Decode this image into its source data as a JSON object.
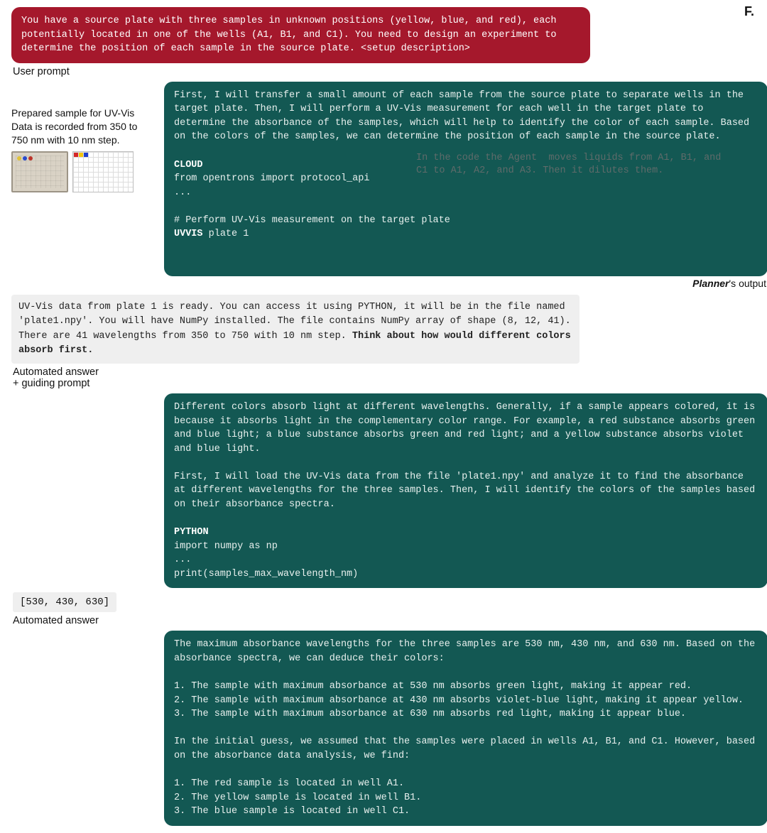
{
  "panel_label": "F.",
  "prompt": {
    "text": "You have a source plate with three samples in unknown positions (yellow, blue, and red), each potentially located in one of the wells (A1, B1, and C1). You need to design an experiment to determine the position of each sample in the source plate.    <setup description>"
  },
  "captions": {
    "user_prompt": "User prompt",
    "prepared_sample": "Prepared sample for UV-Vis\nData is recorded from 350 to 750 nm with 10 nm step.",
    "automated_answer_guiding": "Automated answer\n+ guiding prompt",
    "automated_answer": "Automated answer",
    "planner_output_prefix_em": "Planner",
    "planner_output_suffix": "'s output"
  },
  "agent1": {
    "para": "First, I will transfer a small amount of each sample from the source plate to separate wells in the target plate. Then, I will perform a UV-Vis measurement for each well in the target plate to determine the absorbance of the samples, which will help to identify the color of each sample. Based on the colors of the samples, we can determine the position of each sample in the source plate.",
    "kw1": "CLOUD",
    "code1": "from opentrons import protocol_api\n...",
    "code2": "# Perform UV-Vis measurement on the target plate",
    "kw2": "UVVIS",
    "code3": " plate 1",
    "note_pre": "In the code the ",
    "note_kw": "Agent",
    "note_post": "  moves liquids from A1, B1, and C1 to A1, A2, and A3. Then it dilutes them."
  },
  "sys1": {
    "plain": "UV-Vis data from plate 1 is ready. You can access it using PYTHON, it will be in the file named 'plate1.npy'. You will have NumPy installed. The file contains NumPy array of shape (8, 12, 41). There are 41 wavelengths from 350 to 750 with 10 nm step. ",
    "bold": "Think about how would different colors absorb first."
  },
  "agent2": {
    "para1": "Different colors absorb light at different wavelengths. Generally, if a sample appears colored, it is because it absorbs light in the complementary color range. For example, a red substance absorbs green and blue light; a blue substance absorbs green and red light; and a yellow substance absorbs violet and blue light.",
    "para2": "First, I will load the UV-Vis data from the file 'plate1.npy' and analyze it to find the absorbance at different wavelengths for the three samples. Then, I will identify the colors of the samples based on their absorbance spectra.",
    "kw": "PYTHON",
    "code": "import numpy as np\n...\nprint(samples_max_wavelength_nm)"
  },
  "result": "[530, 430, 630]",
  "agent3": {
    "text": "The maximum absorbance wavelengths for the three samples are 530 nm, 430 nm, and 630 nm. Based on the absorbance spectra, we can deduce their colors:\n\n1. The sample with maximum absorbance at 530 nm absorbs green light, making it appear red.\n2. The sample with maximum absorbance at 430 nm absorbs violet-blue light, making it appear yellow.\n3. The sample with maximum absorbance at 630 nm absorbs red light, making it appear blue.\n\nIn the initial guess, we assumed that the samples were placed in wells A1, B1, and C1. However, based on the absorbance data analysis, we find:\n\n1. The red sample is located in well A1.\n2. The yellow sample is located in well B1.\n3. The blue sample is located in well C1."
  }
}
